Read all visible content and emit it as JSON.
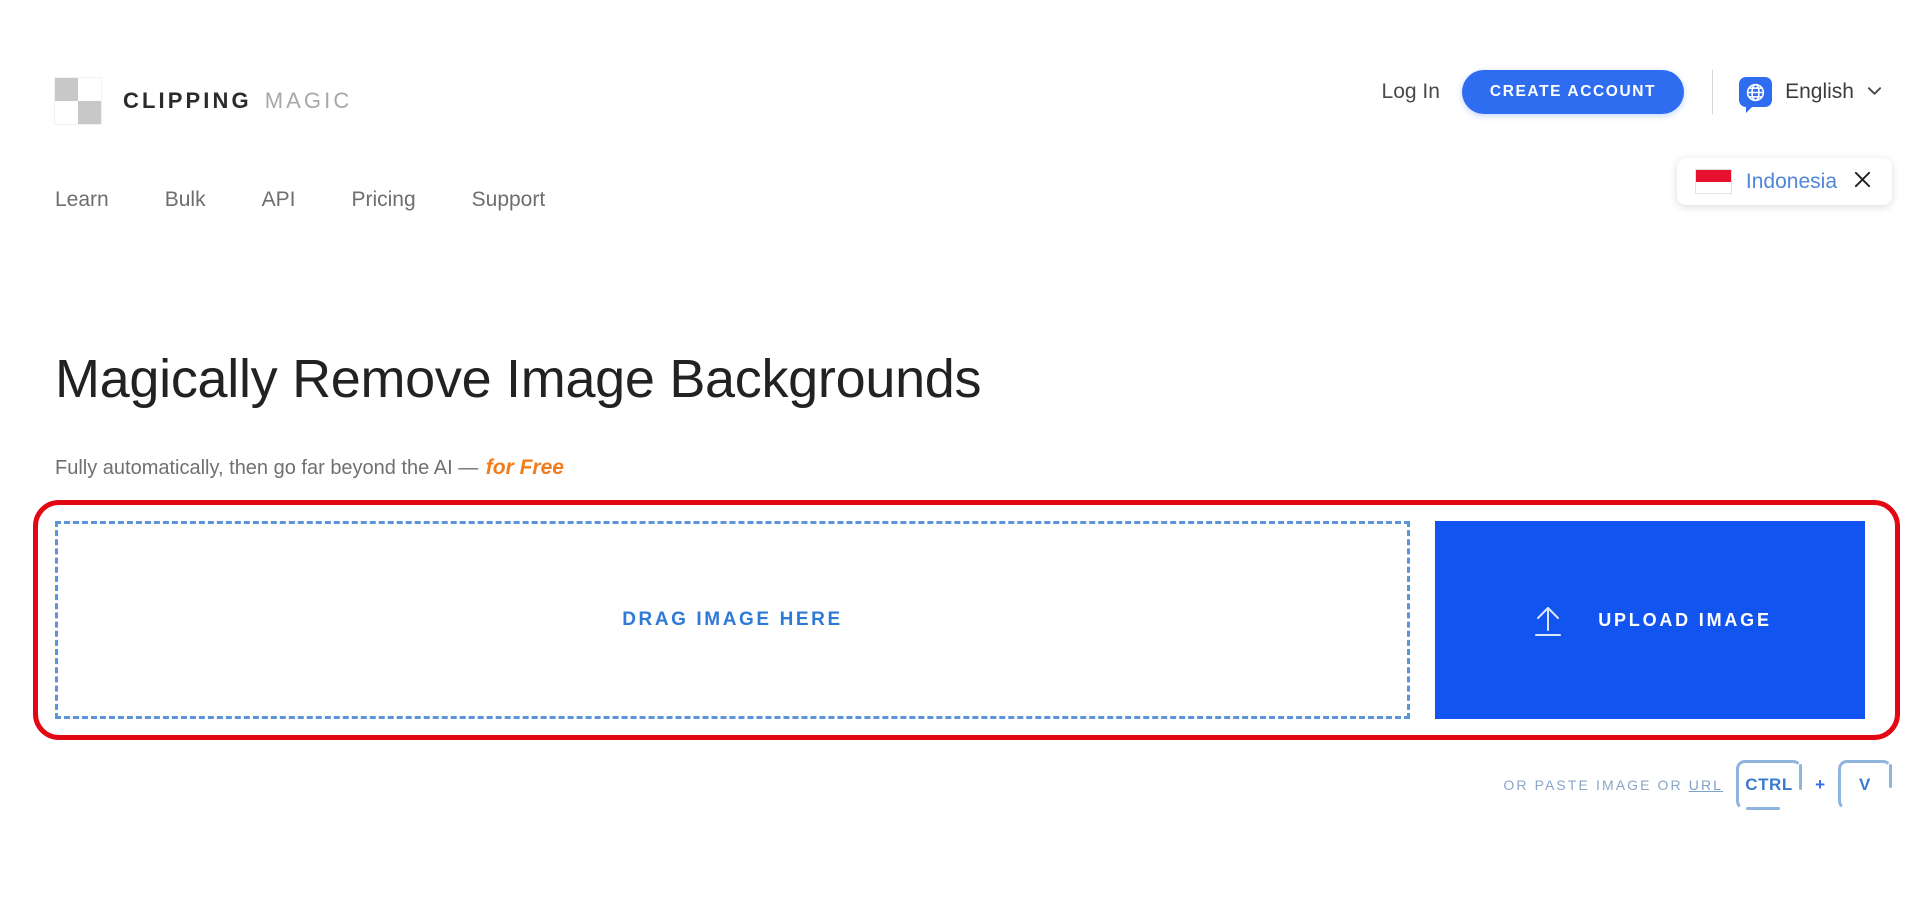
{
  "header": {
    "logo": {
      "primary": "CLIPPING",
      "secondary": "MAGIC",
      "icon": "checkerboard-logo-icon"
    },
    "login_label": "Log In",
    "create_account_label": "CREATE ACCOUNT",
    "language": {
      "icon": "globe-speech-bubble-icon",
      "label": "English",
      "chevron": "⌄"
    }
  },
  "country_banner": {
    "flag": "indonesia-flag-icon",
    "label": "Indonesia",
    "close": "×"
  },
  "nav": {
    "items": [
      {
        "label": "Learn"
      },
      {
        "label": "Bulk"
      },
      {
        "label": "API"
      },
      {
        "label": "Pricing"
      },
      {
        "label": "Support"
      }
    ]
  },
  "hero": {
    "title": "Magically Remove Image Backgrounds",
    "subtitle_plain": "Fully automatically, then go far beyond the AI — ",
    "subtitle_accent": "for Free"
  },
  "upload": {
    "drop_zone_label": "DRAG IMAGE HERE",
    "upload_button_label": "UPLOAD IMAGE",
    "upload_icon": "upload-arrow-icon"
  },
  "paste_hint": {
    "text_prefix": "OR PASTE IMAGE OR ",
    "url_label": "URL",
    "key_ctrl": "CTRL",
    "key_plus": "+",
    "key_v": "V"
  },
  "annotation": {
    "shape": "red-rounded-rectangle-highlight"
  },
  "colors": {
    "brand_blue": "#2f6df0",
    "upload_blue": "#1254f0",
    "drop_border_blue": "#5b94dd",
    "accent_orange": "#f07c1c",
    "annotation_red": "#e30613",
    "flag_red": "#e8112d",
    "link_blue": "#4f86d8"
  }
}
